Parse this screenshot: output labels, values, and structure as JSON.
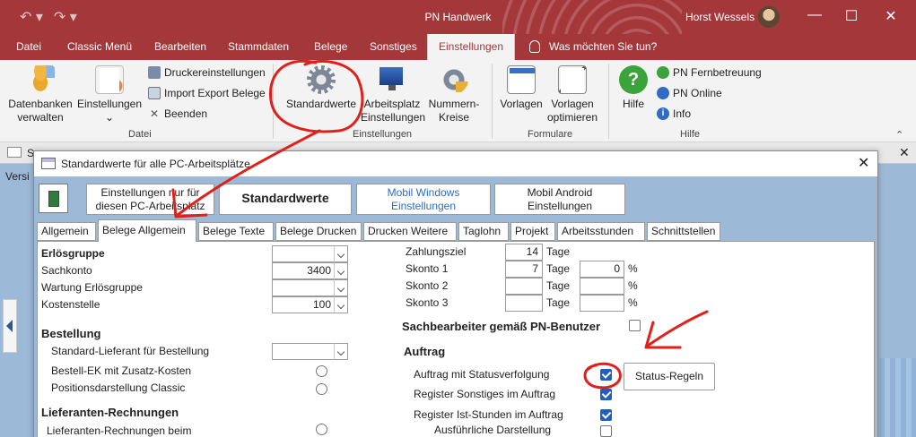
{
  "window": {
    "title": "PN Handwerk",
    "user": "Horst Wessels"
  },
  "ribbon_tabs": [
    "Datei",
    "Classic Menü",
    "Bearbeiten",
    "Stammdaten",
    "Belege",
    "Sonstiges",
    "Einstellungen"
  ],
  "tell_me": "Was möchten Sie tun?",
  "ribbon": {
    "datenbanken": "Datenbanken verwalten",
    "einstellungen": "Einstellungen",
    "druckereinstellungen": "Druckereinstellungen",
    "import_export": "Import Export Belege",
    "beenden": "Beenden",
    "standardwerte": "Standardwerte",
    "arbeitsplatz": "Arbeitsplatz Einstellungen",
    "nummernkreise": "Nummern-Kreise",
    "vorlagen": "Vorlagen",
    "vorlagen_opt": "Vorlagen optimieren",
    "hilfe": "Hilfe",
    "fernbetreuung": "PN Fernbetreuung",
    "online": "PN Online",
    "info": "Info",
    "groups": {
      "datei": "Datei",
      "einstellungen": "Einstellungen",
      "formulare": "Formulare",
      "hilfe": "Hilfe"
    }
  },
  "background": {
    "doc_tab": "S",
    "version_text": "Versi"
  },
  "dialog": {
    "title": "Standardwerte für alle PC-Arbeitsplätze",
    "main_buttons": {
      "einst_pc": "Einstellungen nur für diesen PC-Arbeitsplatz",
      "standardwerte": "Standardwerte",
      "mobil_windows": "Mobil Windows Einstellungen",
      "mobil_android": "Mobil Android Einstellungen"
    },
    "subtabs": [
      "Allgemein",
      "Belege Allgemein",
      "Belege Texte",
      "Belege Drucken",
      "Drucken Weitere",
      "Taglohn",
      "Projekt",
      "Arbeitsstunden",
      "Schnittstellen"
    ],
    "left": {
      "erloesgruppe": "Erlösgruppe",
      "sachkonto": "Sachkonto",
      "sachkonto_value": "3400",
      "wartung": "Wartung Erlösgruppe",
      "kostenstelle": "Kostenstelle",
      "kostenstelle_value": "100",
      "bestellung": "Bestellung",
      "std_lieferant": "Standard-Lieferant für Bestellung",
      "bestell_ek": "Bestell-EK mit Zusatz-Kosten",
      "positionsdarstellung": "Positionsdarstellung Classic",
      "lieferanten_rechnungen": "Lieferanten-Rechnungen",
      "lieferanten_beim": "Lieferanten-Rechnungen beim"
    },
    "right": {
      "zahlungsziel": "Zahlungsziel",
      "zahlungsziel_value": "14",
      "tage": "Tage",
      "skonto1": "Skonto 1",
      "skonto1_value": "7",
      "skonto1_pct": "0",
      "skonto2": "Skonto 2",
      "skonto3": "Skonto 3",
      "percent": "%",
      "sachbearbeiter": "Sachbearbeiter gemäß PN-Benutzer",
      "auftrag": "Auftrag",
      "statusverfolgung": "Auftrag mit Statusverfolgung",
      "status_regeln": "Status-Regeln",
      "register_sonstiges": "Register Sonstiges im Auftrag",
      "register_ist": "Register Ist-Stunden im Auftrag",
      "ausfuehrlich": "Ausführliche Darstellung"
    }
  },
  "colors": {
    "titlebar": "#a4373a",
    "annotation": "#e0201a",
    "check": "#1f5fbf"
  }
}
